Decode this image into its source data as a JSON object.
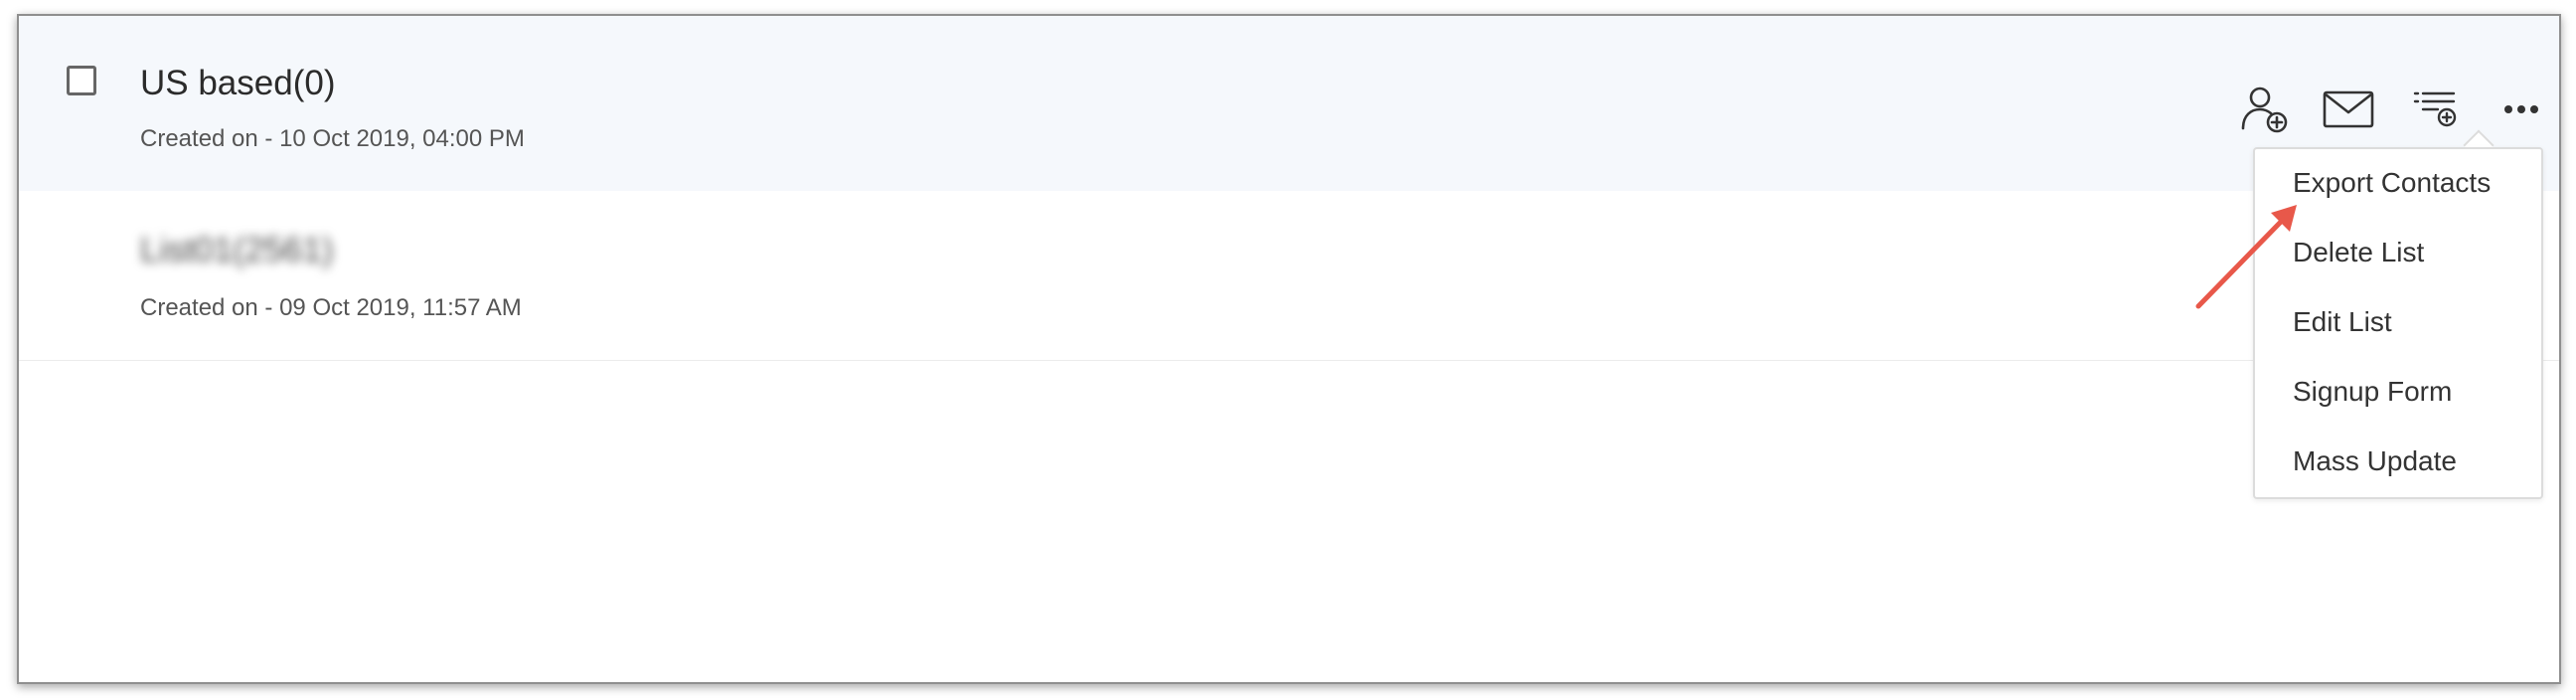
{
  "lists": [
    {
      "name": "US based(0)",
      "created": "Created on - 10 Oct 2019, 04:00 PM"
    },
    {
      "name": "List01(2561)",
      "created": "Created on - 09 Oct 2019, 11:57 AM"
    }
  ],
  "actions": [
    "add-contact-icon",
    "email-icon",
    "add-to-list-icon",
    "more-icon"
  ],
  "menu": {
    "items": [
      "Export Contacts",
      "Delete List",
      "Edit List",
      "Signup Form",
      "Mass Update"
    ]
  },
  "colors": {
    "selected_row_bg": "#f5f8fc",
    "annotation_arrow": "#e8584a",
    "icon_stroke": "#333333"
  }
}
